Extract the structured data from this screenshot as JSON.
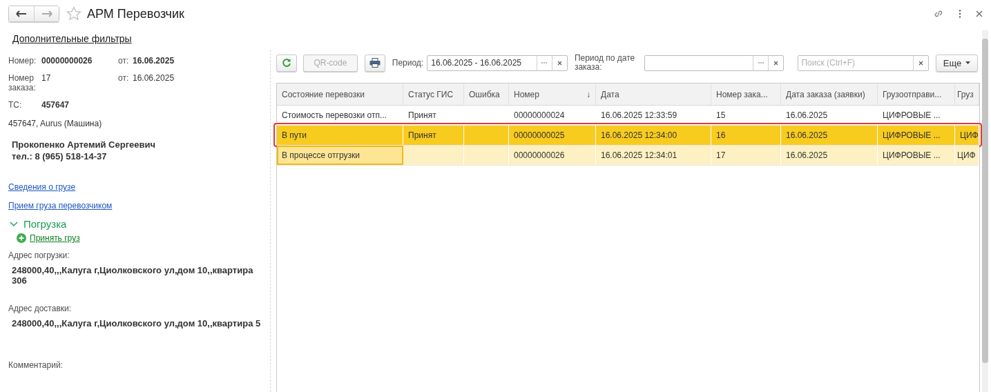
{
  "window": {
    "title": "АРМ Перевозчик",
    "favorite": false
  },
  "filters_link": "Дополнительные фильтры",
  "details": {
    "number_label": "Номер:",
    "number": "00000000026",
    "date_label": "от:",
    "date": "16.06.2025",
    "order_label": "Номер заказа:",
    "order": "17",
    "order_date_label": "от:",
    "order_date": "16.06.2025",
    "vehicle_label": "ТС:",
    "vehicle": "457647",
    "vehicle_desc": "457647, Aurus (Машина)",
    "driver": "Прокопенко Артемий Сергеевич",
    "phone": "тел.: 8 (965) 518-14-37"
  },
  "links": [
    "Сведения о грузе",
    "Прием груза перевозчиком"
  ],
  "loading_group": {
    "title": "Погрузка",
    "expanded": true,
    "action": "Принять груз",
    "fields": [
      {
        "label": "Адрес погрузки:",
        "value": "248000,40,,,Калуга г,Циолковского ул,дом 10,,квартира 306"
      },
      {
        "label": "Адрес доставки:",
        "value": "248000,40,,,Калуга г,Циолковского ул,дом 10,,квартира 5"
      },
      {
        "label": "Комментарий:"
      }
    ]
  },
  "toolbar": {
    "qr_button": {
      "label": "QR-code",
      "disabled": true
    },
    "period_label": "Период:",
    "period_value": "16.06.2025 - 16.06.2025",
    "order_period_label": "Период по дате заказа:",
    "search": {
      "placeholder": "Поиск (Ctrl+F)"
    },
    "more_button": "Еще"
  },
  "table": {
    "columns": [
      {
        "label": "Состояние перевозки"
      },
      {
        "label": "Статус ГИС"
      },
      {
        "label": "Ошибка"
      },
      {
        "label": "Номер",
        "sort": "↓"
      },
      {
        "label": "Дата"
      },
      {
        "label": "Номер зака..."
      },
      {
        "label": "Дата заказа (заявки)"
      },
      {
        "label": "Грузоотправи..."
      },
      {
        "label": "Груз"
      }
    ],
    "rows": [
      {
        "cells": [
          "Стоимость перевозки отп...",
          "Принят",
          "",
          "00000000024",
          "16.06.2025 12:33:59",
          "15",
          "16.06.2025",
          "ЦИФРОВЫЕ ...",
          ""
        ],
        "selected": false,
        "current": false,
        "annotated": false
      },
      {
        "cells": [
          "В пути",
          "Принят",
          "",
          "00000000025",
          "16.06.2025 12:34:00",
          "16",
          "16.06.2025",
          "ЦИФРОВЫЕ ...",
          "ЦИФ"
        ],
        "selected": true,
        "current": false,
        "annotated": true
      },
      {
        "cells": [
          "В процессе отгрузки",
          "",
          "",
          "00000000026",
          "16.06.2025 12:34:01",
          "17",
          "16.06.2025",
          "ЦИФРОВЫЕ ...",
          "ЦИФ"
        ],
        "selected": false,
        "current": true,
        "annotated": false
      }
    ]
  }
}
